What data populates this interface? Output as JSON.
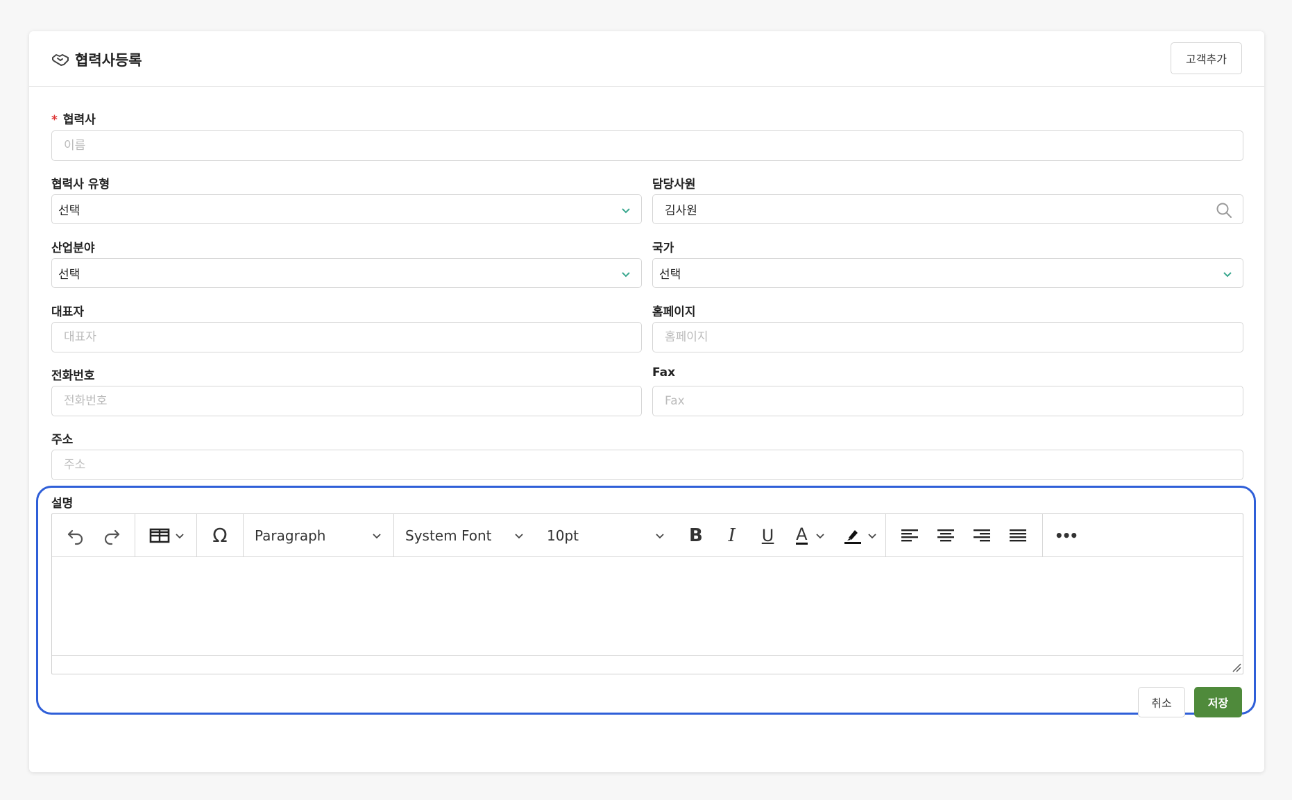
{
  "header": {
    "title": "협력사등록",
    "title_icon": "handshake-icon",
    "add_customer_button": "고객추가"
  },
  "form": {
    "partner": {
      "label": "협력사",
      "required": true,
      "placeholder": "이름",
      "value": ""
    },
    "partner_type": {
      "label": "협력사 유형",
      "value": "선택"
    },
    "manager": {
      "label": "담당사원",
      "value": "김사원"
    },
    "industry": {
      "label": "산업분야",
      "value": "선택"
    },
    "country": {
      "label": "국가",
      "value": "선택"
    },
    "ceo": {
      "label": "대표자",
      "placeholder": "대표자",
      "value": ""
    },
    "homepage": {
      "label": "홈페이지",
      "placeholder": "홈페이지",
      "value": ""
    },
    "phone": {
      "label": "전화번호",
      "placeholder": "전화번호",
      "value": ""
    },
    "fax": {
      "label": "Fax",
      "placeholder": "Fax",
      "value": ""
    },
    "address": {
      "label": "주소",
      "placeholder": "주소",
      "value": ""
    },
    "description": {
      "label": "설명"
    }
  },
  "editor": {
    "block_format": "Paragraph",
    "font_family": "System Font",
    "font_size": "10pt",
    "buttons": {
      "bold": "B",
      "italic": "I",
      "underline": "U",
      "text_color": "A",
      "special_char": "Ω",
      "more": "•••"
    }
  },
  "actions": {
    "cancel": "취소",
    "save": "저장"
  },
  "colors": {
    "accent_green": "#4f8a3b",
    "chevron_teal": "#3aa88f",
    "highlight_blue": "#2f5fd8",
    "required_red": "#dd3333"
  }
}
